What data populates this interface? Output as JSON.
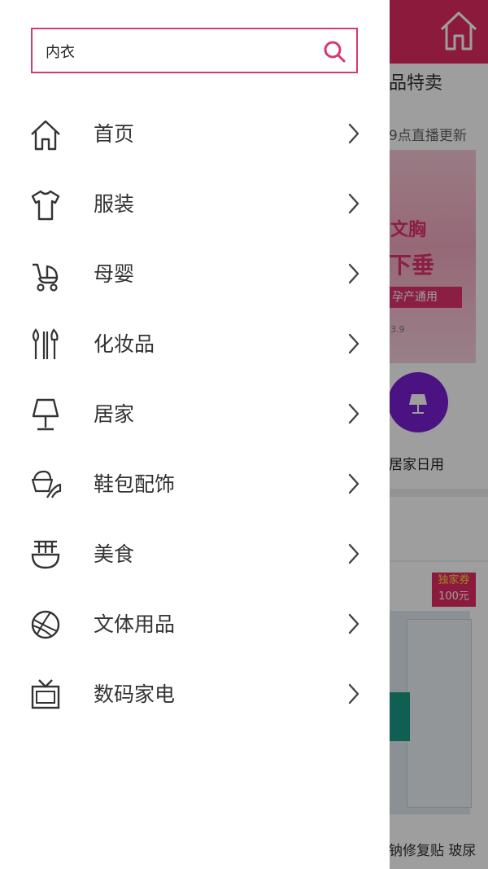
{
  "search": {
    "value": "内衣"
  },
  "menu": [
    {
      "label": "首页",
      "icon": "home-icon"
    },
    {
      "label": "服装",
      "icon": "tshirt-icon"
    },
    {
      "label": "母婴",
      "icon": "stroller-icon"
    },
    {
      "label": "化妆品",
      "icon": "makeup-brushes-icon"
    },
    {
      "label": "居家",
      "icon": "lamp-icon"
    },
    {
      "label": "鞋包配饰",
      "icon": "shoe-bag-icon"
    },
    {
      "label": "美食",
      "icon": "noodle-bowl-icon"
    },
    {
      "label": "文体用品",
      "icon": "basketball-icon"
    },
    {
      "label": "数码家电",
      "icon": "tv-icon"
    }
  ],
  "background": {
    "section_title": "品特卖",
    "section_subtitle": "9点直播更新",
    "banner_line1": "文胸",
    "banner_line2": "下垂",
    "banner_line3": "孕产通用",
    "banner_price": "3.9",
    "category_label": "居家日用",
    "badge_line1": "独家券",
    "badge_line2": "100元",
    "product_title": "钠修复贴 玻尿"
  },
  "colors": {
    "accent": "#e32b62",
    "search_border": "#d9386c",
    "category_circle": "#7a1fd1"
  }
}
